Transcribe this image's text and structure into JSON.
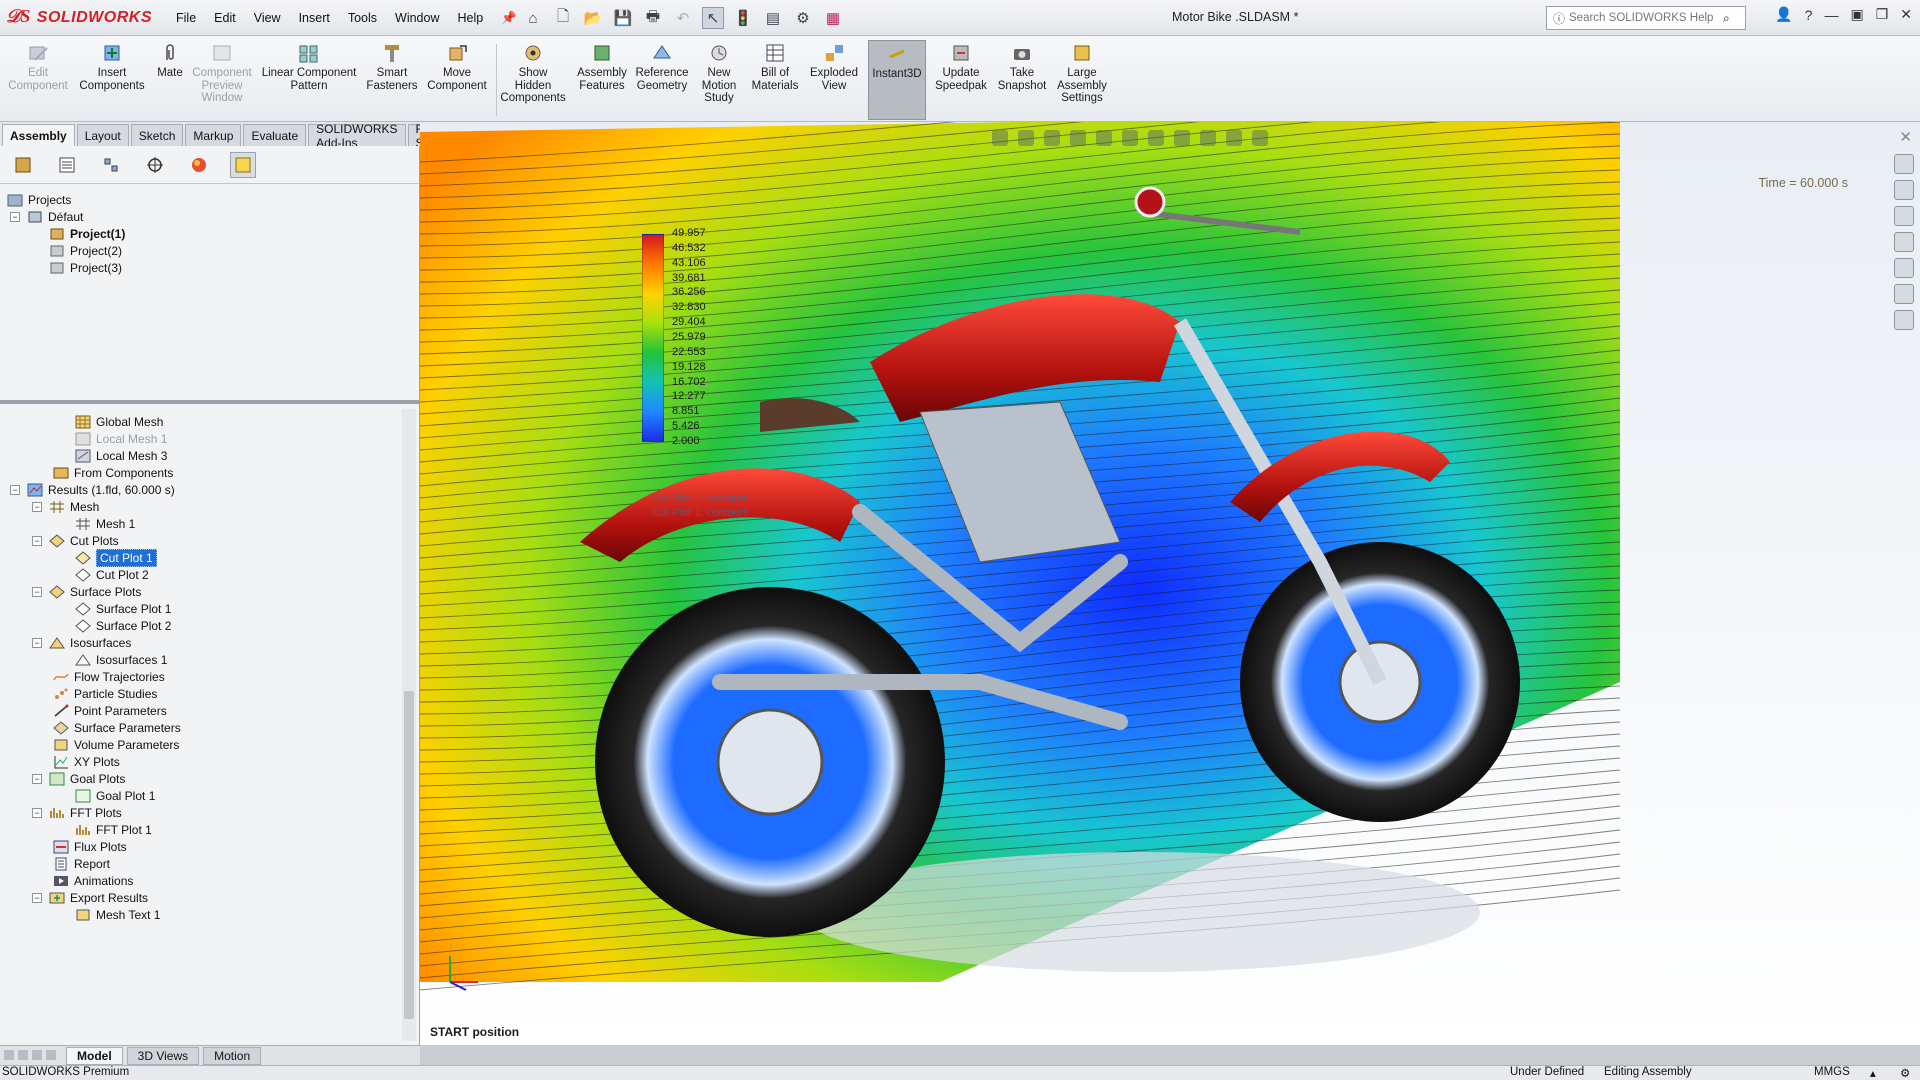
{
  "app": {
    "brand": "SOLIDWORKS",
    "document_title": "Motor Bike .SLDASM *",
    "menus": [
      "File",
      "Edit",
      "View",
      "Insert",
      "Tools",
      "Window",
      "Help"
    ],
    "search_placeholder": "Search SOLIDWORKS Help"
  },
  "toolbar": {
    "edit_component": "Edit Component",
    "insert_components": "Insert Components",
    "mate": "Mate",
    "component_preview_window": "Component Preview Window",
    "linear_component_pattern": "Linear Component Pattern",
    "smart_fasteners": "Smart Fasteners",
    "move_component": "Move Component",
    "show_hidden_components": "Show Hidden Components",
    "assembly_features": "Assembly Features",
    "reference_geometry": "Reference Geometry",
    "new_motion_study": "New Motion Study",
    "bill_of_materials": "Bill of Materials",
    "exploded_view": "Exploded View",
    "instant3d": "Instant3D",
    "update_speedpak": "Update Speedpak",
    "take_snapshot": "Take Snapshot",
    "large_assembly_settings": "Large Assembly Settings"
  },
  "tabs": [
    "Assembly",
    "Layout",
    "Sketch",
    "Markup",
    "Evaluate",
    "SOLIDWORKS Add-Ins",
    "Flow Simulation"
  ],
  "projects_tree": {
    "root": "Projects",
    "config": "Défaut",
    "items": [
      "Project(1)",
      "Project(2)",
      "Project(3)"
    ]
  },
  "results_tree": {
    "global_mesh": "Global Mesh",
    "local_mesh_1": "Local Mesh 1",
    "local_mesh_3": "Local Mesh 3",
    "from_components": "From Components",
    "results": "Results (1.fld, 60.000 s)",
    "mesh": "Mesh",
    "mesh_1": "Mesh 1",
    "cut_plots": "Cut Plots",
    "cut_plot_1": "Cut Plot 1",
    "cut_plot_2": "Cut Plot 2",
    "surface_plots": "Surface Plots",
    "surface_plot_1": "Surface Plot 1",
    "surface_plot_2": "Surface Plot 2",
    "isosurfaces": "Isosurfaces",
    "isosurfaces_1": "Isosurfaces 1",
    "flow_trajectories": "Flow Trajectories",
    "particle_studies": "Particle Studies",
    "point_parameters": "Point Parameters",
    "surface_parameters": "Surface Parameters",
    "volume_parameters": "Volume Parameters",
    "xy_plots": "XY Plots",
    "goal_plots": "Goal Plots",
    "goal_plot_1": "Goal Plot 1",
    "fft_plots": "FFT Plots",
    "fft_plot_1": "FFT Plot 1",
    "flux_plots": "Flux Plots",
    "report": "Report",
    "animations": "Animations",
    "export_results": "Export Results",
    "mesh_text_1": "Mesh Text 1"
  },
  "bottom_tabs": [
    "Model",
    "3D Views",
    "Motion"
  ],
  "status": {
    "product": "SOLIDWORKS Premium",
    "state": "Under Defined",
    "mode": "Editing Assembly",
    "units": "MMGS"
  },
  "viewport": {
    "time": "Time = 60.000 s",
    "start_label": "START position",
    "legend_values": [
      "49.957",
      "46.532",
      "43.106",
      "39.681",
      "36.256",
      "32.830",
      "29.404",
      "25.979",
      "22.553",
      "19.128",
      "16.702",
      "12.277",
      "8.851",
      "5.426",
      "2.000"
    ],
    "legend_caption_1": "Cut Plot 1: contours",
    "legend_caption_2": "Cut Plot 1: contours"
  },
  "colors": {
    "brand_red": "#d81e25",
    "selection_blue": "#1f6fd6"
  }
}
